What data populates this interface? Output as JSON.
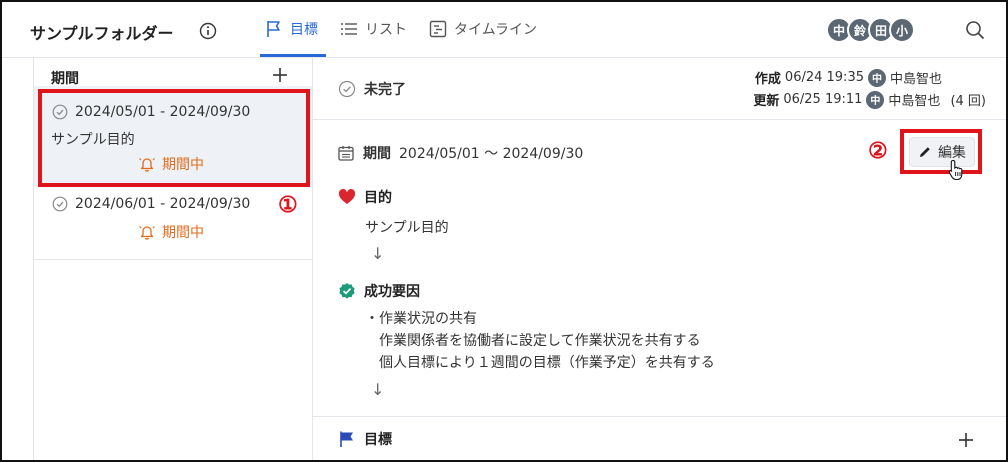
{
  "header": {
    "folder_title": "サンプルフォルダー",
    "tabs": [
      {
        "label": "目標",
        "icon": "flag-icon",
        "active": true
      },
      {
        "label": "リスト",
        "icon": "list-icon",
        "active": false
      },
      {
        "label": "タイムライン",
        "icon": "timeline-icon",
        "active": false
      }
    ],
    "avatars": [
      "中",
      "鈴",
      "田",
      "小"
    ]
  },
  "sidebar": {
    "header": "期間",
    "items": [
      {
        "range": "2024/05/01 - 2024/09/30",
        "goal": "サンプル目的",
        "status": "期間中",
        "selected": true
      },
      {
        "range": "2024/06/01 - 2024/09/30",
        "goal": "",
        "status": "期間中",
        "selected": false
      }
    ]
  },
  "detail": {
    "status": "未完了",
    "created": {
      "label": "作成",
      "datetime": "06/24 19:35",
      "avatar": "中",
      "user": "中島智也"
    },
    "updated": {
      "label": "更新",
      "datetime": "06/25 19:11",
      "avatar": "中",
      "user": "中島智也",
      "count": "(4 回)"
    },
    "period_label": "期間",
    "period_value": "2024/05/01 〜 2024/09/30",
    "edit_label": "編集",
    "purpose_label": "目的",
    "purpose_value": "サンプル目的",
    "success_label": "成功要因",
    "success_lines": [
      "・作業状況の共有",
      "作業関係者を協働者に設定して作業状況を共有する",
      "個人目標により１週間の目標（作業予定）を共有する"
    ],
    "arrow": "↓",
    "goal_label": "目標"
  },
  "annotations": {
    "callout1": "①",
    "callout2": "②"
  },
  "colors": {
    "accent": "#2a6ad6",
    "status_orange": "#e36b1c",
    "annotation_red": "#e0141b",
    "heart": "#d9262f",
    "check_green": "#1f9a7a"
  }
}
